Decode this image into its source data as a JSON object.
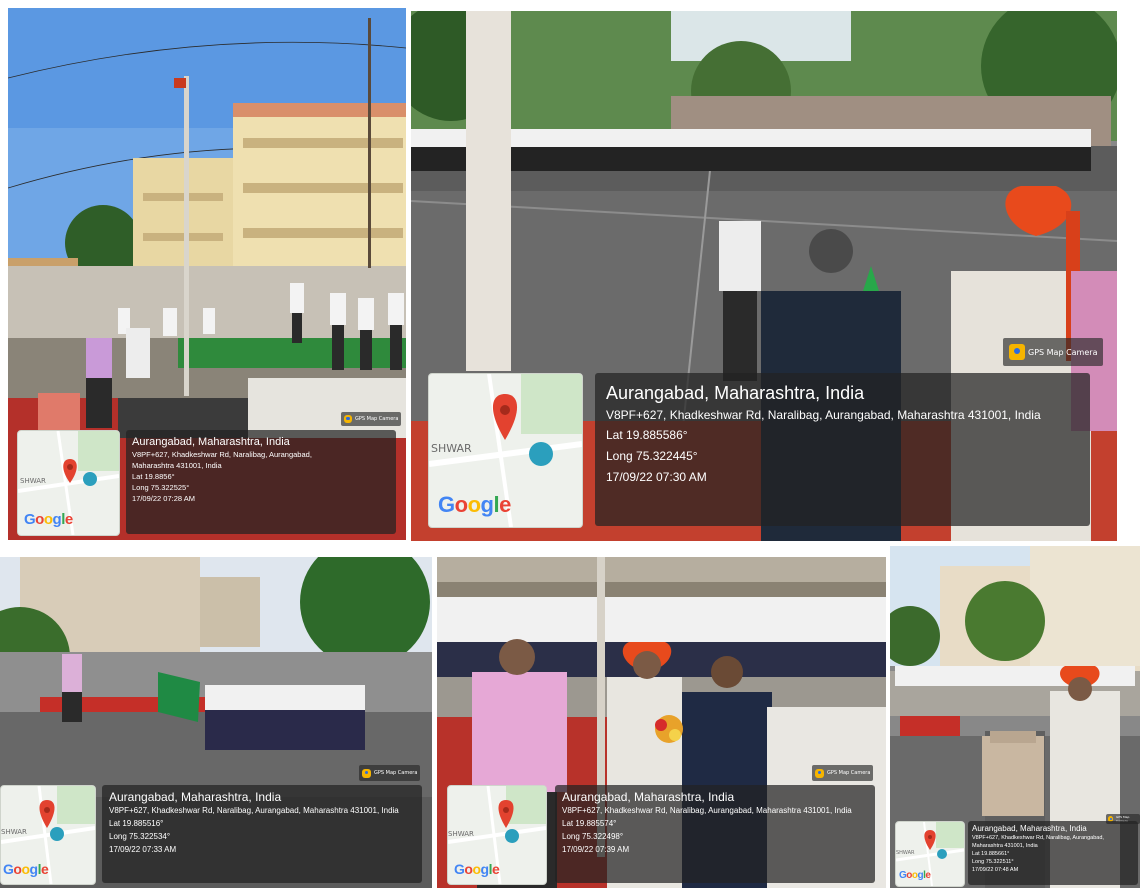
{
  "gps_badge_text": "GPS Map Camera",
  "map_place_label": "SHWAR",
  "google_logo": [
    "G",
    "o",
    "o",
    "g",
    "l",
    "e"
  ],
  "google_colors": [
    "#4285f4",
    "#ea4335",
    "#fbbc05",
    "#4285f4",
    "#34a853",
    "#ea4335"
  ],
  "photos": [
    {
      "location": "Aurangabad, Maharashtra, India",
      "address": "V8PF+627, Khadkeshwar Rd, Naralibag, Aurangabad, Maharashtra 431001, India",
      "lat": "Lat 19.8856°",
      "long": "Long 75.322525°",
      "datetime": "17/09/22 07:28 AM"
    },
    {
      "location": "Aurangabad, Maharashtra, India",
      "address": "V8PF+627, Khadkeshwar Rd, Naralibag, Aurangabad, Maharashtra 431001, India",
      "lat": "Lat 19.885586°",
      "long": "Long 75.322445°",
      "datetime": "17/09/22 07:30 AM"
    },
    {
      "location": "Aurangabad, Maharashtra, India",
      "address": "V8PF+627, Khadkeshwar Rd, Naralibag, Aurangabad, Maharashtra 431001, India",
      "lat": "Lat 19.885516°",
      "long": "Long 75.322534°",
      "datetime": "17/09/22 07:33 AM"
    },
    {
      "location": "Aurangabad, Maharashtra, India",
      "address": "V8PF+627, Khadkeshwar Rd, Naralibag, Aurangabad, Maharashtra 431001, India",
      "lat": "Lat 19.885574°",
      "long": "Long 75.322498°",
      "datetime": "17/09/22 07:39 AM"
    },
    {
      "location": "Aurangabad, Maharashtra, India",
      "address": "V8PF+627, Khadkeshwar Rd, Naralibag, Aurangabad, Maharashtra 431001, India",
      "lat": "Lat 19.885661°",
      "long": "Long 75.322511°",
      "datetime": "17/09/22 07:48 AM"
    }
  ],
  "colors": {
    "sky": "#7fb0e8",
    "building": "#e9d8a8",
    "carpet": "#c22a25",
    "turf": "#2f8a3c",
    "uniform": "#f2f2f2",
    "tree": "#3d6e2e",
    "ground_wet": "#6b6b6b",
    "turban": "#e84a1c"
  }
}
